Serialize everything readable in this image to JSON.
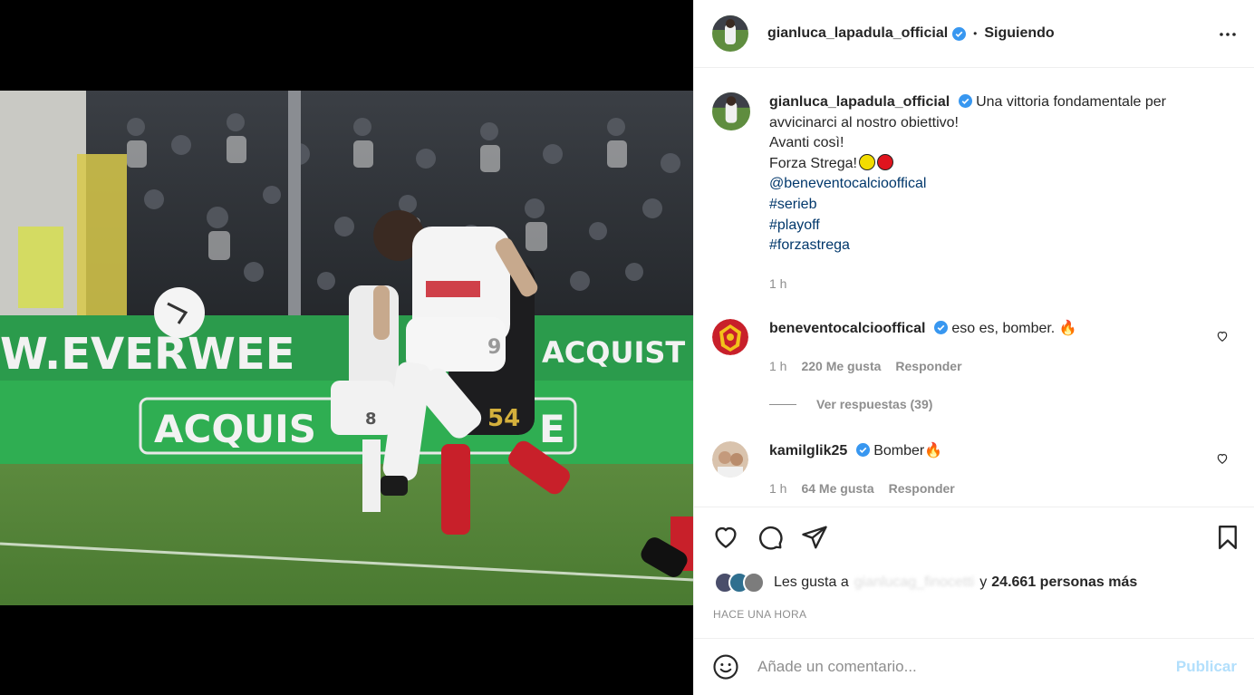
{
  "colors": {
    "accent": "#0095f6",
    "verified": "#3897f0",
    "link": "#00376b",
    "muted": "#8e8e8e",
    "publish_disabled": "#b2dffc"
  },
  "photo": {
    "banner_top": "W.EVERWEE",
    "banner_top_right": "ACQUIST",
    "banner_bottom": "ACQUIS",
    "banner_bottom_right": "E",
    "player_number": "8",
    "opponent_number": "54",
    "striker_number": "9"
  },
  "header": {
    "username": "gianluca_lapadula_official",
    "separator": "•",
    "follow_status": "Siguiendo",
    "verified_icon": "verified-badge-icon",
    "more_icon": "more-options-icon"
  },
  "caption": {
    "username": "gianluca_lapadula_official",
    "text_line1": "Una vittoria fondamentale per avvicinarci al nostro obiettivo!",
    "text_line2": "Avanti così!",
    "text_line3": "Forza Strega!",
    "emoji_1_color": "#f2dc00",
    "emoji_2_color": "#e0141e",
    "mention": "@beneventocalciooffical",
    "hashtags": [
      "#serieb",
      "#playoff",
      "#forzastrega"
    ],
    "time": "1 h"
  },
  "comments": [
    {
      "username": "beneventocalciooffical",
      "text": "eso es, bomber. 🔥",
      "time": "1 h",
      "likes": "220 Me gusta",
      "reply": "Responder",
      "view_replies": "Ver respuestas (39)"
    },
    {
      "username": "kamilglik25",
      "text": "Bomber🔥",
      "time": "1 h",
      "likes": "64 Me gusta",
      "reply": "Responder"
    }
  ],
  "actions": {
    "like_icon": "heart-icon",
    "comment_icon": "comment-bubble-icon",
    "share_icon": "paper-plane-icon",
    "save_icon": "bookmark-icon"
  },
  "likes": {
    "prefix": "Les gusta a",
    "liked_by": "gianlucag_finocetti",
    "connector": "y",
    "count_text": "24.661 personas más"
  },
  "timestamp": "HACE UNA HORA",
  "add_comment": {
    "emoji_icon": "smiley-icon",
    "placeholder": "Añade un comentario...",
    "publish_label": "Publicar"
  }
}
